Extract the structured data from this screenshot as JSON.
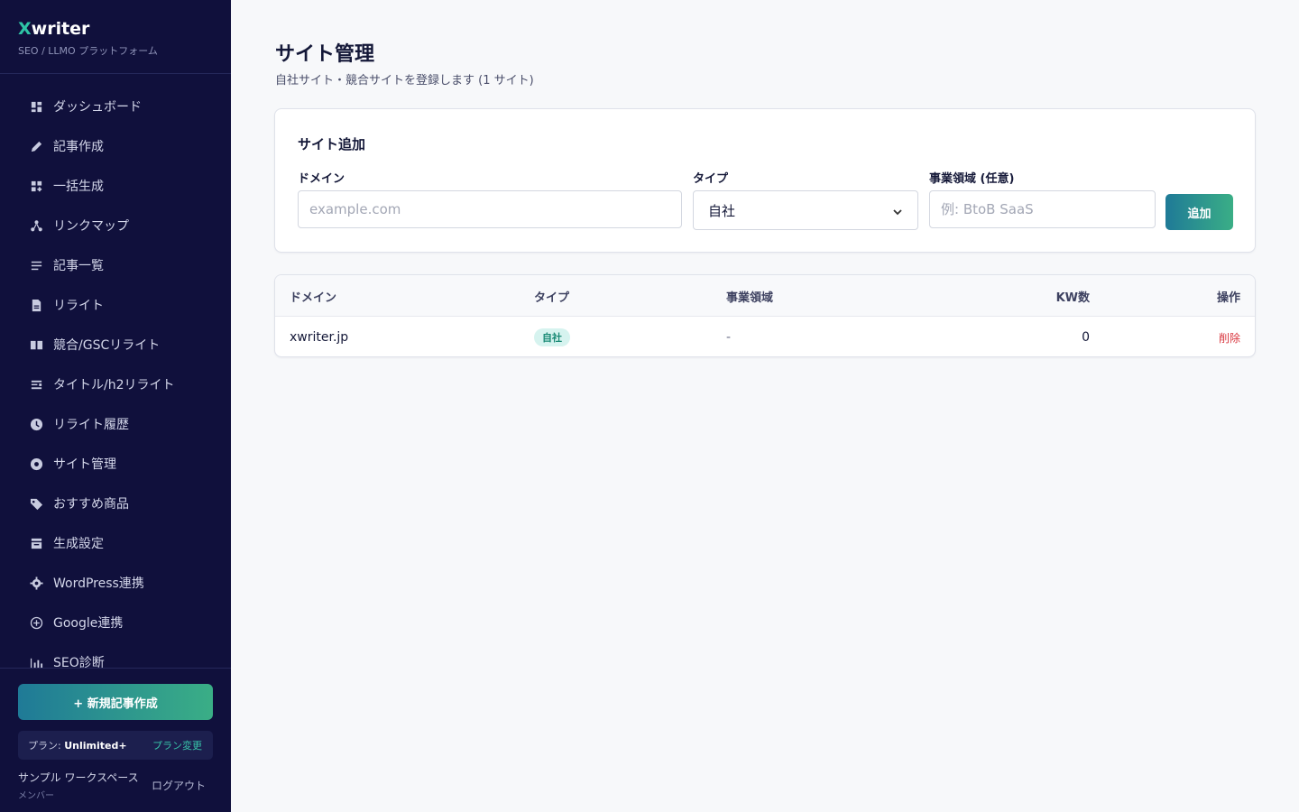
{
  "brand": {
    "x": "X",
    "rest": "writer",
    "subtitle": "SEO / LLMO プラットフォーム"
  },
  "nav": [
    {
      "label": "ダッシュボード",
      "icon": "dashboard-icon"
    },
    {
      "label": "記事作成",
      "icon": "pencil-icon"
    },
    {
      "label": "一括生成",
      "icon": "grid-plus-icon"
    },
    {
      "label": "リンクマップ",
      "icon": "link-map-icon"
    },
    {
      "label": "記事一覧",
      "icon": "list-icon"
    },
    {
      "label": "リライト",
      "icon": "document-icon"
    },
    {
      "label": "競合/GSCリライト",
      "icon": "book-icon"
    },
    {
      "label": "タイトル/h2リライト",
      "icon": "title-icon"
    },
    {
      "label": "リライト履歴",
      "icon": "clock-icon"
    },
    {
      "label": "サイト管理",
      "icon": "site-icon"
    },
    {
      "label": "おすすめ商品",
      "icon": "tag-icon"
    },
    {
      "label": "生成設定",
      "icon": "settings-box-icon"
    },
    {
      "label": "WordPress連携",
      "icon": "gear-icon"
    },
    {
      "label": "Google連携",
      "icon": "plus-circle-icon"
    },
    {
      "label": "SEO診断",
      "icon": "chart-icon"
    }
  ],
  "sidebar_bottom": {
    "new_article": "+ 新規記事作成",
    "plan_prefix": "プラン: ",
    "plan_name": "Unlimited+",
    "plan_change": "プラン変更",
    "workspace": "サンプル ワークスペース",
    "role": "メンバー",
    "logout": "ログアウト"
  },
  "page": {
    "title": "サイト管理",
    "subtitle": "自社サイト・競合サイトを登録します (1 サイト)"
  },
  "add_form": {
    "title": "サイト追加",
    "domain_label": "ドメイン",
    "domain_placeholder": "example.com",
    "type_label": "タイプ",
    "type_value": "自社",
    "business_label": "事業領域 (任意)",
    "business_placeholder": "例: BtoB SaaS",
    "add_button": "追加"
  },
  "table": {
    "headers": {
      "domain": "ドメイン",
      "type": "タイプ",
      "business": "事業領域",
      "kw": "KW数",
      "ops": "操作"
    },
    "rows": [
      {
        "domain": "xwriter.jp",
        "type": "自社",
        "business": "-",
        "kw": "0",
        "op": "削除"
      }
    ]
  },
  "colors": {
    "sidebar": "#10103c",
    "accent": "#2ec4a6",
    "danger": "#d9363e"
  }
}
